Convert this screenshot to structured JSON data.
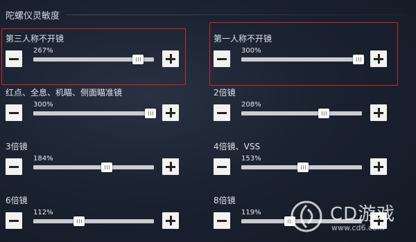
{
  "header": {
    "title": "陀螺仪灵敏度"
  },
  "colors": {
    "highlight": "#d8242a",
    "track": "#c9ccd1",
    "button": "#f2f2f2"
  },
  "settings": [
    {
      "label": "第三人称不开镜",
      "value_text": "267%",
      "value": 267,
      "max": 300,
      "highlighted": true
    },
    {
      "label": "第一人称不开镜",
      "value_text": "300%",
      "value": 300,
      "max": 300,
      "highlighted": true
    },
    {
      "label": "红点、全息、机瞄、侧面瞄准镜",
      "value_text": "300%",
      "value": 300,
      "max": 300,
      "highlighted": false
    },
    {
      "label": "2倍镜",
      "value_text": "208%",
      "value": 208,
      "max": 300,
      "highlighted": false
    },
    {
      "label": "3倍镜",
      "value_text": "184%",
      "value": 184,
      "max": 300,
      "highlighted": false
    },
    {
      "label": "4倍镜、VSS",
      "value_text": "153%",
      "value": 153,
      "max": 300,
      "highlighted": false
    },
    {
      "label": "6倍镜",
      "value_text": "112%",
      "value": 112,
      "max": 300,
      "highlighted": false
    },
    {
      "label": "8倍镜",
      "value_text": "119%",
      "value": 119,
      "max": 300,
      "highlighted": false
    }
  ],
  "icons": {
    "decrease": "minus-icon",
    "increase": "plus-icon"
  },
  "watermark": {
    "brand": "CD游戏",
    "url": "www.cd6.com"
  }
}
